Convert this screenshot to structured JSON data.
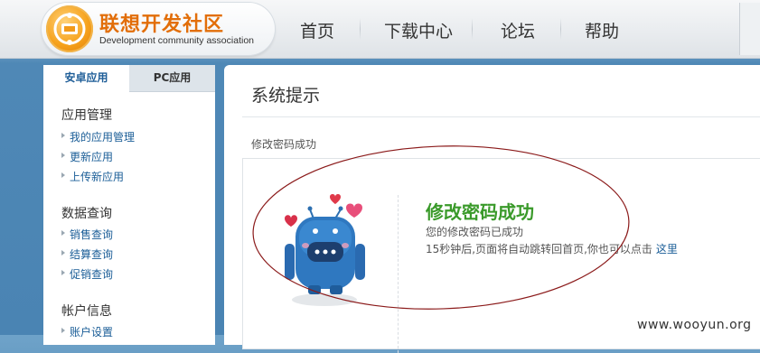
{
  "header": {
    "logo_title": "联想开发社区",
    "logo_subtitle": "Development community association",
    "nav": [
      "首页",
      "下载中心",
      "论坛",
      "帮助"
    ]
  },
  "sidebar": {
    "tabs": [
      {
        "label": "安卓应用",
        "active": true
      },
      {
        "label": "PC应用",
        "active": false
      }
    ],
    "sections": [
      {
        "title": "应用管理",
        "links": [
          "我的应用管理",
          "更新应用",
          "上传新应用"
        ]
      },
      {
        "title": "数据查询",
        "links": [
          "销售查询",
          "结算查询",
          "促销查询"
        ]
      },
      {
        "title": "帐户信息",
        "links": [
          "账户设置"
        ]
      }
    ]
  },
  "main": {
    "title": "系统提示",
    "breadcrumb": "修改密码成功",
    "message": {
      "heading": "修改密码成功",
      "line1": "您的修改密码已成功",
      "line2_prefix": "15秒钟后,页面将自动跳转回首页,你也可以点击",
      "link_label": "这里"
    }
  },
  "watermark": "www.wooyun.org",
  "colors": {
    "brand_orange": "#e26e09",
    "link_blue": "#1a5d97",
    "success_green": "#3a9a2a",
    "annotation_red": "#8b1a1a"
  }
}
